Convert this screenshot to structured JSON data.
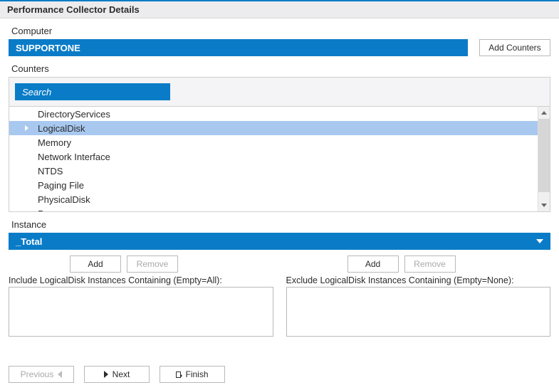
{
  "panel": {
    "title": "Performance Collector Details"
  },
  "computer": {
    "label": "Computer",
    "value": "SUPPORTONE",
    "add_counters_label": "Add Counters"
  },
  "counters": {
    "label": "Counters",
    "search_placeholder": "Search",
    "items": [
      {
        "label": "DirectoryServices",
        "selected": false
      },
      {
        "label": "LogicalDisk",
        "selected": true
      },
      {
        "label": "Memory",
        "selected": false
      },
      {
        "label": "Network Interface",
        "selected": false
      },
      {
        "label": "NTDS",
        "selected": false
      },
      {
        "label": "Paging File",
        "selected": false
      },
      {
        "label": "PhysicalDisk",
        "selected": false
      },
      {
        "label": "Process",
        "selected": false
      }
    ]
  },
  "instance": {
    "label": "Instance",
    "value": "_Total"
  },
  "include": {
    "add": "Add",
    "remove": "Remove",
    "label": "Include LogicalDisk Instances Containing (Empty=All):"
  },
  "exclude": {
    "add": "Add",
    "remove": "Remove",
    "label": "Exclude LogicalDisk Instances Containing (Empty=None):"
  },
  "wizard": {
    "previous": "Previous",
    "next": "Next",
    "finish": "Finish"
  }
}
